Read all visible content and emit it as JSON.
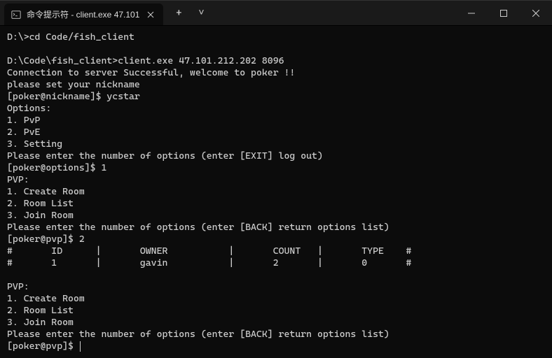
{
  "window": {
    "tab_title": "命令提示符 - client.exe  47.101"
  },
  "controls": {
    "new_tab": "+",
    "dropdown": "˅"
  },
  "terminal": {
    "lines": [
      "D:\\>cd Code/fish_client",
      "",
      "D:\\Code\\fish_client>client.exe 47.101.212.202 8096",
      "Connection to server Successful, welcome to poker !!",
      "please set your nickname",
      "[poker@nickname]$ ycstar",
      "Options:",
      "1. PvP",
      "2. PvE",
      "3. Setting",
      "Please enter the number of options (enter [EXIT] log out)",
      "[poker@options]$ 1",
      "PVP:",
      "1. Create Room",
      "2. Room List",
      "3. Join Room",
      "Please enter the number of options (enter [BACK] return options list)",
      "[poker@pvp]$ 2",
      "#       ID      |       OWNER           |       COUNT   |       TYPE    #",
      "#       1       |       gavin           |       2       |       0       #",
      "",
      "PVP:",
      "1. Create Room",
      "2. Room List",
      "3. Join Room",
      "Please enter the number of options (enter [BACK] return options list)"
    ],
    "prompt": "[poker@pvp]$ "
  }
}
